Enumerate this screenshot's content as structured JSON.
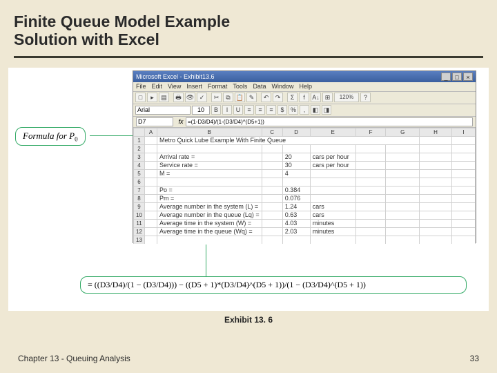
{
  "slide": {
    "title_line1": "Finite Queue Model Example",
    "title_line2": "Solution with Excel",
    "exhibit_caption": "Exhibit 13. 6",
    "footer_left": "Chapter 13 - Queuing Analysis",
    "footer_right": "33"
  },
  "callouts": {
    "p0_prefix": "Formula for ",
    "p0_var": "P",
    "p0_sub": "0",
    "formula": "= ((D3/D4)/(1 − (D3/D4))) − ((D5 + 1)*(D3/D4)^(D5 + 1))/(1 − (D3/D4)^(D5 + 1))"
  },
  "excel": {
    "title": "Microsoft Excel - Exhibit13.6",
    "menus": [
      "File",
      "Edit",
      "View",
      "Insert",
      "Format",
      "Tools",
      "Data",
      "Window",
      "Help"
    ],
    "font_name": "Arial",
    "font_size": "10",
    "zoom": "120%",
    "win_min": "_",
    "win_max": "□",
    "win_close": "×",
    "cell_ref": "D7",
    "formula_bar": "=(1-D3/D4)/(1-(D3/D4)^(D5+1))",
    "tb_icons": [
      "□",
      "▸",
      "▤",
      "🖶",
      "👁",
      "✓",
      "✂",
      "⧉",
      "📋",
      "✎",
      "↶",
      "↷",
      "Σ",
      "f",
      "A↓",
      "⊞",
      "?"
    ],
    "fmt_icons": [
      "B",
      "I",
      "U",
      "≡",
      "≡",
      "≡",
      "$",
      "%",
      "‚",
      "◧",
      "◨"
    ],
    "columns": [
      "",
      "A",
      "B",
      "C",
      "D",
      "E",
      "F",
      "G",
      "H",
      "I"
    ],
    "rows": {
      "r1_b": "Metro Quick Lube Example With Finite Queue",
      "r3_b": "Arrival rate =",
      "r3_d": "20",
      "r3_e": "cars per hour",
      "r4_b": "Service rate =",
      "r4_d": "30",
      "r4_e": "cars per hour",
      "r5_b": "M =",
      "r5_d": "4",
      "r7_b": "Po =",
      "r7_d": "0.384",
      "r8_b": "Pm =",
      "r8_d": "0.076",
      "r9_b": "Average number in the system (L) =",
      "r9_d": "1.24",
      "r9_e": "cars",
      "r10_b": "Average number in the queue (Lq) =",
      "r10_d": "0.63",
      "r10_e": "cars",
      "r11_b": "Average time in the system (W) =",
      "r11_d": "4.03",
      "r11_e": "minutes",
      "r12_b": "Average time in the queue (Wq) =",
      "r12_d": "2.03",
      "r12_e": "minutes"
    }
  }
}
